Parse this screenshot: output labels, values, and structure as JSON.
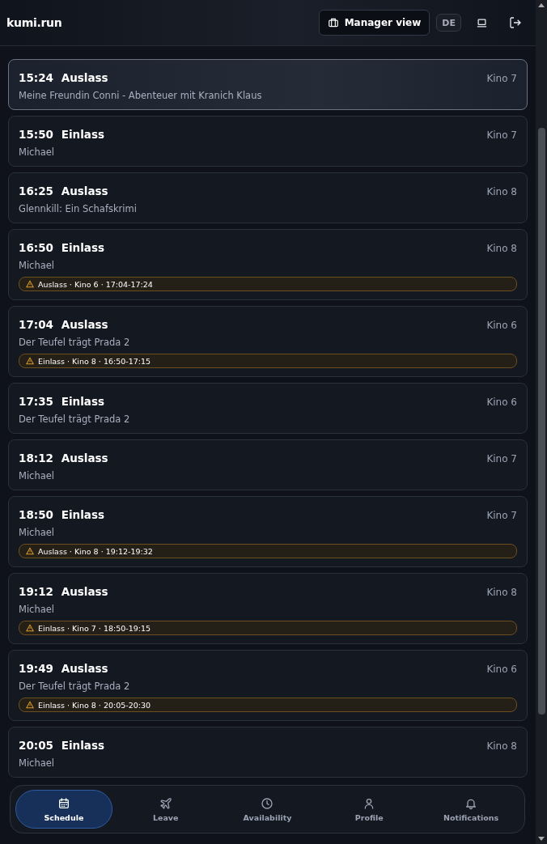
{
  "header": {
    "brand": "kumi.run",
    "manager_button": "Manager view",
    "language": "DE"
  },
  "shifts": [
    {
      "time": "15:24",
      "type": "Auslass",
      "room": "Kino 7",
      "detail": "Meine Freundin Conni - Abenteuer mit Kranich Klaus",
      "selected": true
    },
    {
      "time": "15:50",
      "type": "Einlass",
      "room": "Kino 7",
      "detail": "Michael",
      "selected": false
    },
    {
      "time": "16:25",
      "type": "Auslass",
      "room": "Kino 8",
      "detail": "Glennkill: Ein Schafskrimi",
      "selected": false
    },
    {
      "time": "16:50",
      "type": "Einlass",
      "room": "Kino 8",
      "detail": "Michael",
      "warning": "Auslass · Kino 6 · 17:04-17:24",
      "selected": false
    },
    {
      "time": "17:04",
      "type": "Auslass",
      "room": "Kino 6",
      "detail": "Der Teufel trägt Prada 2",
      "warning": "Einlass · Kino 8 · 16:50-17:15",
      "selected": false
    },
    {
      "time": "17:35",
      "type": "Einlass",
      "room": "Kino 6",
      "detail": "Der Teufel trägt Prada 2",
      "selected": false
    },
    {
      "time": "18:12",
      "type": "Auslass",
      "room": "Kino 7",
      "detail": "Michael",
      "selected": false
    },
    {
      "time": "18:50",
      "type": "Einlass",
      "room": "Kino 7",
      "detail": "Michael",
      "warning": "Auslass · Kino 8 · 19:12-19:32",
      "selected": false
    },
    {
      "time": "19:12",
      "type": "Auslass",
      "room": "Kino 8",
      "detail": "Michael",
      "warning": "Einlass · Kino 7 · 18:50-19:15",
      "selected": false
    },
    {
      "time": "19:49",
      "type": "Auslass",
      "room": "Kino 6",
      "detail": "Der Teufel trägt Prada 2",
      "warning": "Einlass · Kino 8 · 20:05-20:30",
      "selected": false
    },
    {
      "time": "20:05",
      "type": "Einlass",
      "room": "Kino 8",
      "detail": "Michael",
      "selected": false
    }
  ],
  "nav": [
    {
      "label": "Schedule",
      "kind": "calendar",
      "selected": true
    },
    {
      "label": "Leave",
      "kind": "plane",
      "selected": false
    },
    {
      "label": "Availability",
      "kind": "clock",
      "selected": false
    },
    {
      "label": "Profile",
      "kind": "person",
      "selected": false
    },
    {
      "label": "Notifications",
      "kind": "bell",
      "selected": false
    }
  ]
}
